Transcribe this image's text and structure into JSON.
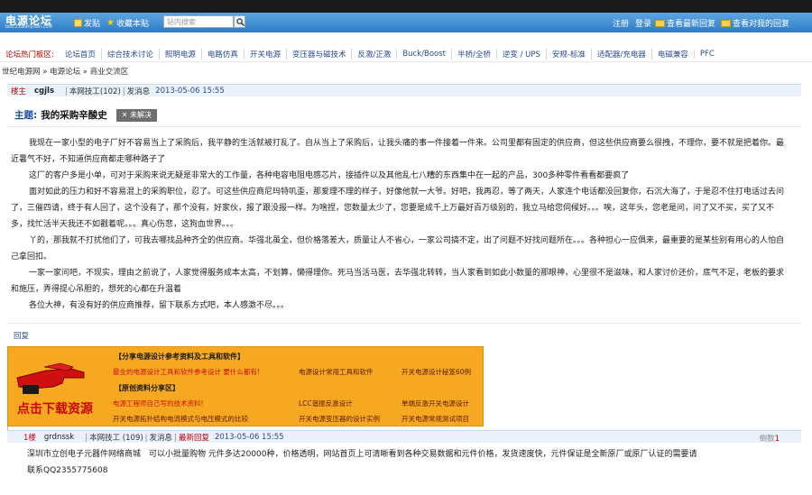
{
  "header": {
    "logo_main": "电源论坛",
    "logo_sub": "bbs.21dianyuan.com",
    "post_label": "发贴",
    "fav_label": "收藏本贴",
    "search_placeholder": "站内搜索",
    "register": "注册",
    "login": "登录",
    "latest_replies": "查看最新回复",
    "my_replies": "查看对我的回复"
  },
  "nav": {
    "hot_label": "论坛热门板区:",
    "categories": [
      "论坛首页",
      "综合技术讨论",
      "照明电源",
      "电路仿真",
      "开关电源",
      "变压器与磁技术",
      "反激/正激",
      "Buck/Boost",
      "半桥/全桥",
      "逆变 / UPS",
      "安规-标准",
      "适配器/充电器",
      "电磁兼容",
      "PFC"
    ]
  },
  "breadcrumb": "世纪电源网 » 电源论坛 » 商业交流区",
  "post1": {
    "floor": "楼主",
    "user": "cgjls",
    "meta_a": "本网技工(102)",
    "meta_b": "发消息",
    "date": "2013-05-06 15:55",
    "topic_label": "主题:",
    "title": "我的采购辛酸史",
    "status": "未解决",
    "paragraphs": [
      "我现在一家小型的电子厂好不容易当上了采购后，我平静的生活就被打乱了。自从当上了采购后，让我头痛的事一件接着一件来。公司里都有固定的供应商，但这些供应商要么很拽，不理你，要不就是把着你。最近暑气不好，不知道供应商都走哪种路子了",
      "这厂的客户多是小单，可对于采购来说无疑是非常大的工作量，各种电容电阻电感芯片，接插件以及其他乱七八糟的东西集中在一起的产品，300多种零件看看都要疯了",
      "面对如此的压力和好不容易混上的采购职位，忍了。可这些供应商尼玛特叽歪，那爱理不理的样子，好像他就一大爷。好吧，我再忍，等了两天，人家连个电话都没回复你，石沉大海了，于是忍不住打电话过去问了，三催四请，终于有人回了，这个没有了，那个没有，好家伙，报了跟没报一样。为啥捏，您数量太少了，您要是成千上万最好百万级别的，我立马给您伺候好。。。唉，这年头，您老是问，问了又不买，买了又不多，找忙活半天我还不如戳着呢。。。真心伤悲，这狗血世界。。。",
      "丫的，那我就不打扰他们了，可我去哪找品种齐全的供应商。华强北虽全，但价格落差大，质量让人不省心，一家公司搞不定，出了问题不好找问题所在。。。各种担心一应俱来，最重要的是某些别有用心的人怕自己拿回扣。",
      "一家一家问吧，不现实，理由之前说了，人家觉得服务成本太高，不划算，懒得理你。死马当活马医，去华强北转转，当人家看到如此小数量的那眼神，心里很不是滋味，和人家讨价还价，底气不足，老板的要求和施压，弄得提心吊胆的，想死的心都在升温着",
      "各位大神，有没有好的供应商推荐，留下联系方式吧，本人感激不尽。。。"
    ],
    "reply_label": "回复"
  },
  "banner": {
    "cta": "点击下载资源",
    "share_title": "【分享电源设计参考资料及工具和软件】",
    "share_red": "最全的电源设计工具和软件参考设计 要什么都有!",
    "share_items": [
      "电源设计常用工具和软件",
      "开关电源设计秘笈60例"
    ],
    "orig_title": "【原创资料分享区】",
    "orig_red": "电源工程师自己写的技术资料!",
    "orig_items": [
      "LCC谐振反激设计",
      "单端反激开关电源设计",
      "开关电源拓扑结构电流模式与电压模式的比较",
      "开关电源变压器的设计实例",
      "开关电源常规测试项目"
    ]
  },
  "post2": {
    "floor": "1楼",
    "user": "grdnssk",
    "meta_a": "本网技工 (109)",
    "meta_b": "发消息",
    "latest_label": "最新回复",
    "date": "2013-05-06 15:55",
    "reverse_label": "倒数",
    "reverse_num": "1",
    "body_line1": "深圳市立创电子元器件网络商城　可以小批量购物 元件多达20000种，价格透明，网站首页上可清晰看到各种交易数据和元件价格，发货速度快，元件保证是全新原厂或原厂认证的需要请",
    "body_line2": "联系QQ2355775608"
  },
  "colors": {
    "header": "#3d8ad2",
    "nav_link": "#2a4d8c",
    "accent_red": "#c00000",
    "banner": "#f7a821"
  },
  "icons": [
    "post-icon",
    "star-icon",
    "search-icon",
    "mail-icon",
    "hand-icon"
  ]
}
